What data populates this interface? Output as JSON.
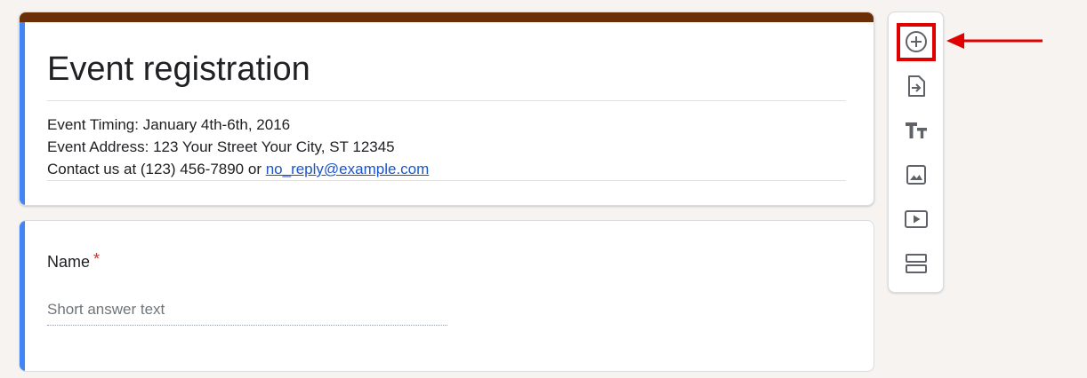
{
  "form": {
    "title": "Event registration",
    "description": {
      "line1": "Event Timing: January 4th-6th, 2016",
      "line2": "Event Address: 123 Your Street Your City, ST 12345",
      "line3_prefix": "Contact us at (123) 456-7890 or ",
      "email_link": "no_reply@example.com"
    }
  },
  "question": {
    "title": "Name",
    "required_mark": "*",
    "placeholder": "Short answer text"
  },
  "toolbar": {
    "items": [
      {
        "name": "add-question",
        "icon": "add-circle-icon"
      },
      {
        "name": "import-questions",
        "icon": "import-icon"
      },
      {
        "name": "add-title-description",
        "icon": "title-text-icon"
      },
      {
        "name": "add-image",
        "icon": "image-icon"
      },
      {
        "name": "add-video",
        "icon": "video-icon"
      },
      {
        "name": "add-section",
        "icon": "section-icon"
      }
    ]
  },
  "colors": {
    "theme_header": "#6b2f07",
    "accent": "#4285f4",
    "required": "#d93025",
    "highlight": "#e00000",
    "link": "#1a55c9",
    "background": "#f6f3f0"
  }
}
